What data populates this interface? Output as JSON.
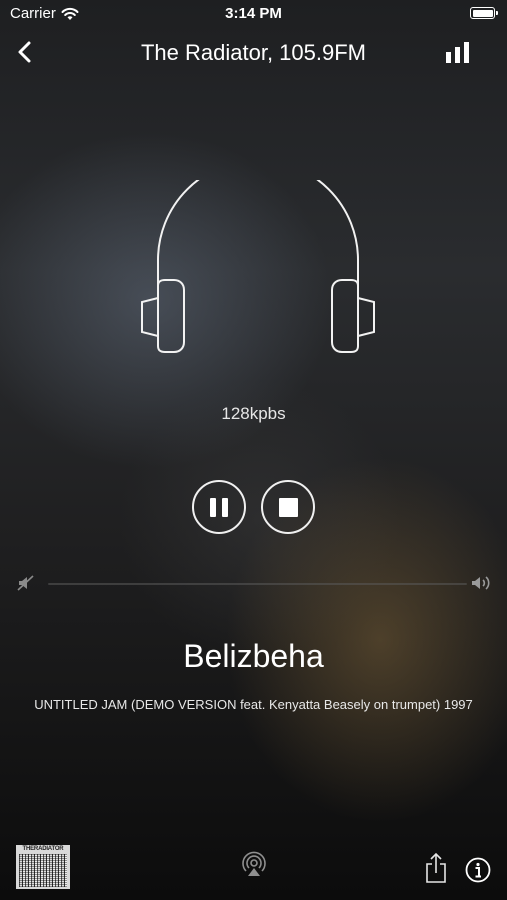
{
  "status_bar": {
    "carrier": "Carrier",
    "time": "3:14 PM"
  },
  "nav": {
    "title": "The Radiator, 105.9FM",
    "back_icon": "chevron-left-icon",
    "stats_icon": "bar-chart-icon"
  },
  "player": {
    "bitrate": "128kpbs",
    "pause_icon": "pause-icon",
    "stop_icon": "stop-icon",
    "volume_level": 0.0
  },
  "now_playing": {
    "artist": "Belizbeha",
    "track": "UNTITLED JAM  (DEMO VERSION feat. Kenyatta Beasely on trumpet)  1997"
  },
  "footer": {
    "thumbnail_label": "THERADIATOR",
    "airplay_icon": "airplay-icon",
    "share_icon": "share-icon",
    "info_icon": "info-icon"
  },
  "colors": {
    "foreground": "#ffffff",
    "track_bg": "#5a5a5a"
  }
}
